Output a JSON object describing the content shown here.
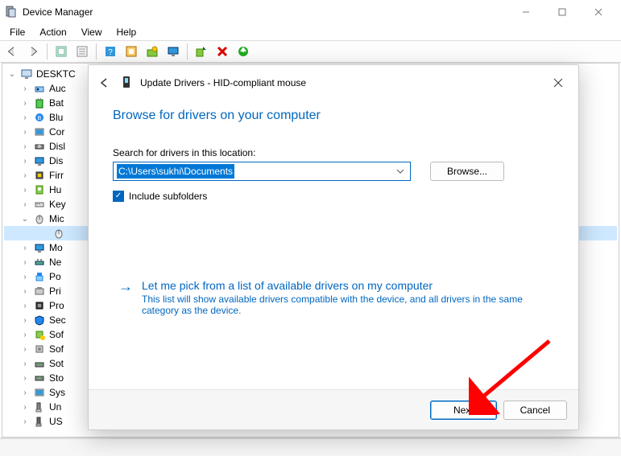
{
  "window": {
    "title": "Device Manager"
  },
  "menu": {
    "file": "File",
    "action": "Action",
    "view": "View",
    "help": "Help"
  },
  "tree": {
    "root": "DESKTC",
    "items": [
      {
        "label": "Auc"
      },
      {
        "label": "Bat"
      },
      {
        "label": "Blu"
      },
      {
        "label": "Cor"
      },
      {
        "label": "Disl"
      },
      {
        "label": "Dis"
      },
      {
        "label": "Firr"
      },
      {
        "label": "Hu"
      },
      {
        "label": "Key"
      },
      {
        "label": "Mic",
        "expanded": true
      },
      {
        "label": "Mo"
      },
      {
        "label": "Ne"
      },
      {
        "label": "Po"
      },
      {
        "label": "Pri"
      },
      {
        "label": "Pro"
      },
      {
        "label": "Sec"
      },
      {
        "label": "Sof"
      },
      {
        "label": "Sof"
      },
      {
        "label": "Sot"
      },
      {
        "label": "Sto"
      },
      {
        "label": "Sys"
      },
      {
        "label": "Un"
      },
      {
        "label": "US"
      }
    ]
  },
  "dialog": {
    "title": "Update Drivers - HID-compliant mouse",
    "heading": "Browse for drivers on your computer",
    "location_label": "Search for drivers in this location:",
    "location_value": "C:\\Users\\sukhi\\Documents",
    "browse": "Browse...",
    "include_subfolders": "Include subfolders",
    "include_subfolders_checked": true,
    "link_title": "Let me pick from a list of available drivers on my computer",
    "link_sub": "This list will show available drivers compatible with the device, and all drivers in the same category as the device.",
    "next": "Next",
    "cancel": "Cancel"
  }
}
